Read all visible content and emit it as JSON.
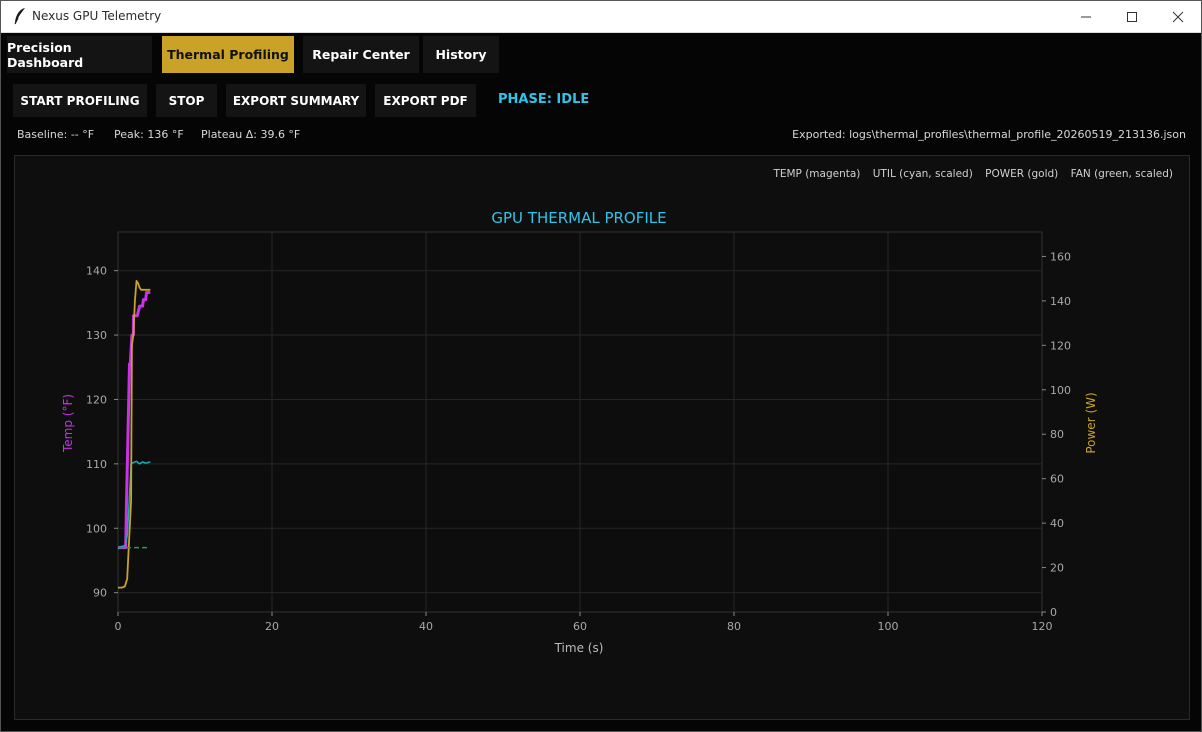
{
  "window": {
    "title": "Nexus GPU Telemetry",
    "controls": [
      "minimize",
      "maximize",
      "close"
    ]
  },
  "tabs": [
    {
      "label": "Precision Dashboard",
      "active": false
    },
    {
      "label": "Thermal Profiling",
      "active": true
    },
    {
      "label": "Repair Center",
      "active": false
    },
    {
      "label": "History",
      "active": false
    }
  ],
  "toolbar": {
    "start_label": "START PROFILING",
    "stop_label": "STOP",
    "export_summary_label": "EXPORT SUMMARY",
    "export_pdf_label": "EXPORT PDF",
    "phase_label": "PHASE: IDLE"
  },
  "stats": {
    "baseline": "Baseline: -- °F",
    "peak": "Peak: 136 °F",
    "plateau": "Plateau Δ: 39.6 °F",
    "exported": "Exported: logs\\thermal_profiles\\thermal_profile_20260519_213136.json"
  },
  "legend": {
    "temp": "TEMP (magenta)",
    "util": "UTIL (cyan, scaled)",
    "power": "POWER (gold)",
    "fan": "FAN (green, scaled)"
  },
  "colors": {
    "accent": "#c9a227",
    "phase": "#2fc4e8",
    "temp": "#c832e8",
    "util": "#1fa8b4",
    "power": "#c9a227",
    "fan": "#2e9a4e"
  },
  "chart_data": {
    "type": "line",
    "title": "GPU THERMAL PROFILE",
    "xlabel": "Time (s)",
    "ylabel": "Temp (°F)",
    "y2label": "Power (W)",
    "xlim": [
      0,
      120
    ],
    "ylim": [
      87,
      146
    ],
    "y2lim": [
      0,
      171
    ],
    "x_ticks": [
      0,
      20,
      40,
      60,
      80,
      100,
      120
    ],
    "y_ticks": [
      90,
      100,
      110,
      120,
      130,
      140
    ],
    "y2_ticks": [
      0,
      20,
      40,
      60,
      80,
      100,
      120,
      140,
      160
    ],
    "grid": true,
    "series": [
      {
        "name": "TEMP",
        "axis": "left",
        "color": "#c832e8",
        "width": 3,
        "x": [
          0,
          1.0,
          1.1,
          1.5,
          1.6,
          1.8,
          2.0,
          2.0,
          2.4,
          2.5,
          2.8,
          3.2,
          3.3,
          3.6,
          3.7,
          4.2
        ],
        "y": [
          97,
          97,
          104,
          125.5,
          125.5,
          130,
          130,
          133,
          133,
          133,
          134.5,
          134.5,
          135.5,
          135.5,
          136.6,
          136.6
        ]
      },
      {
        "name": "UTIL",
        "axis": "left",
        "color": "#1fa8b4",
        "width": 1.5,
        "x": [
          0,
          0.2,
          0.9,
          1.2,
          1.4,
          1.7,
          2.0,
          2.4,
          2.8,
          3.2,
          3.6,
          4.2
        ],
        "y": [
          96.8,
          97.1,
          97.3,
          98.8,
          103,
          110,
          110.2,
          110.4,
          110,
          110.3,
          110.1,
          110.3
        ]
      },
      {
        "name": "POWER",
        "axis": "right",
        "color": "#c9a227",
        "width": 1.8,
        "x": [
          0,
          0.5,
          0.9,
          1.2,
          1.5,
          1.7,
          1.8,
          2.0,
          2.2,
          2.4,
          2.6,
          2.8,
          3.0,
          3.3,
          4.2
        ],
        "y": [
          11,
          11,
          11.5,
          15,
          36,
          50,
          120,
          125,
          140,
          149,
          148,
          146,
          145,
          145,
          145
        ]
      },
      {
        "name": "FAN",
        "axis": "left",
        "color": "#2e9a4e",
        "width": 1.5,
        "dash": "5,3",
        "x": [
          0,
          4.0
        ],
        "y": [
          97,
          97
        ]
      }
    ]
  }
}
